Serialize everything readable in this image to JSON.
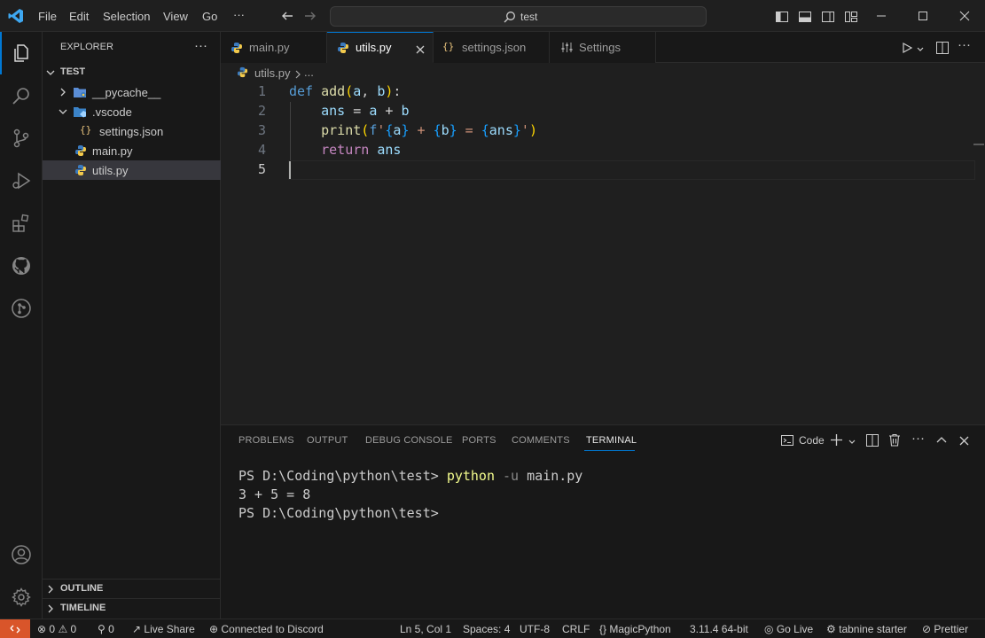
{
  "titlebar": {
    "menu": [
      "File",
      "Edit",
      "Selection",
      "View",
      "Go",
      "···"
    ],
    "search_text": "test"
  },
  "sidebar": {
    "header": "EXPLORER",
    "folder": "TEST",
    "items": [
      {
        "label": "__pycache__",
        "type": "folder"
      },
      {
        "label": ".vscode",
        "type": "folder"
      },
      {
        "label": "settings.json",
        "type": "json"
      },
      {
        "label": "main.py",
        "type": "py"
      },
      {
        "label": "utils.py",
        "type": "py"
      }
    ],
    "outline": "OUTLINE",
    "timeline": "TIMELINE"
  },
  "tabs": [
    {
      "label": "main.py"
    },
    {
      "label": "utils.py"
    },
    {
      "label": "settings.json"
    },
    {
      "label": "Settings"
    }
  ],
  "breadcrumb": {
    "file": "utils.py",
    "rest": "..."
  },
  "editor": {
    "line_numbers": [
      "1",
      "2",
      "3",
      "4",
      "5"
    ]
  },
  "panel": {
    "tabs": [
      "PROBLEMS",
      "OUTPUT",
      "DEBUG CONSOLE",
      "PORTS",
      "COMMENTS",
      "TERMINAL"
    ],
    "terminal_name": "Code",
    "prompt": "PS D:\\Coding\\python\\test>",
    "cmd": "python",
    "flag": "-u",
    "arg": "main.py",
    "output": "3 + 5 = 8"
  },
  "statusbar": {
    "errors": "0",
    "warnings": "0",
    "ports": "0",
    "live_share": "Live Share",
    "discord": "Connected to Discord",
    "position": "Ln 5, Col 1",
    "spaces": "Spaces: 4",
    "encoding": "UTF-8",
    "eol": "CRLF",
    "language": "MagicPython",
    "interpreter": "3.11.4 64-bit",
    "go_live": "Go Live",
    "tabnine": "tabnine starter",
    "prettier": "Prettier"
  },
  "colors": {
    "accent": "#0078d4",
    "remote": "#d9552a",
    "python_blue": "#3b7bbf",
    "python_yellow": "#f2c94c",
    "json_yellow": "#e5c07b"
  }
}
